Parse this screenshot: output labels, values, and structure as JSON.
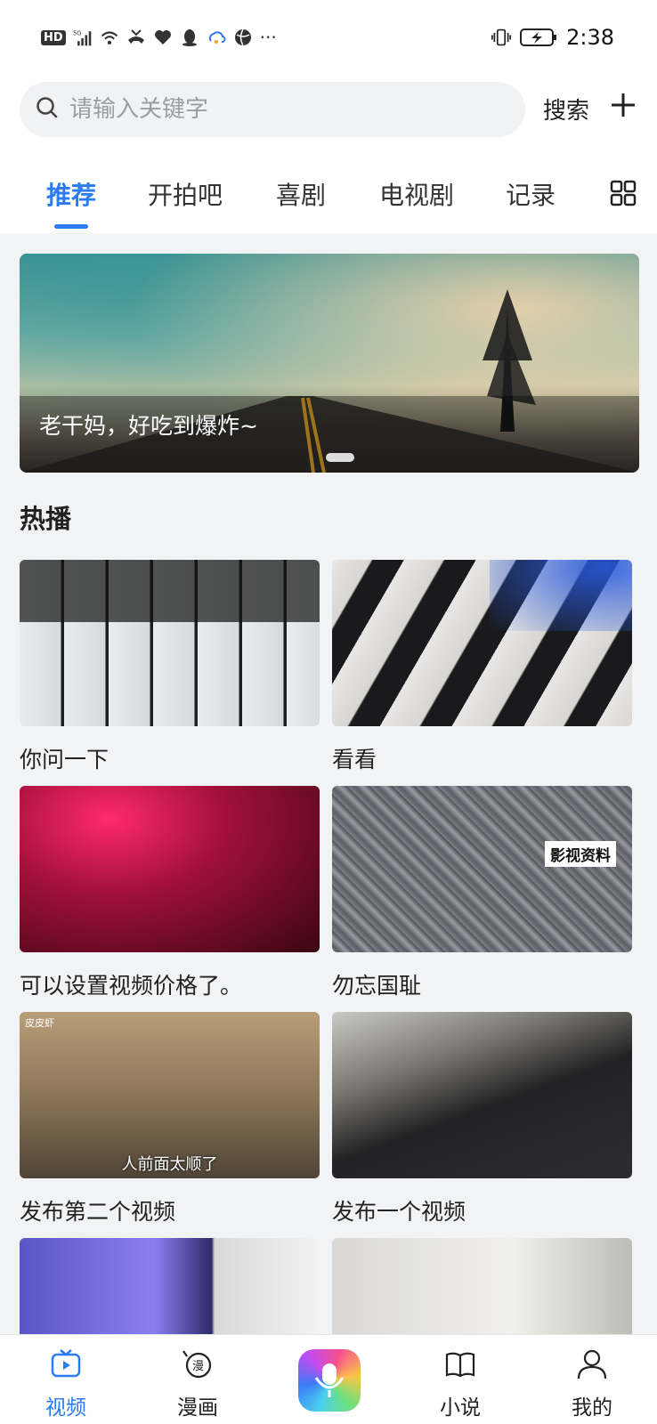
{
  "status_bar": {
    "network_badge": "HD",
    "signal_label": "5G",
    "wifi_label": "6",
    "more": "···",
    "time": "2:38"
  },
  "search": {
    "placeholder": "请输入关键字",
    "button_label": "搜索"
  },
  "tabs": [
    {
      "label": "推荐",
      "active": true
    },
    {
      "label": "开拍吧",
      "active": false
    },
    {
      "label": "喜剧",
      "active": false
    },
    {
      "label": "电视剧",
      "active": false
    },
    {
      "label": "记录",
      "active": false
    }
  ],
  "banner": {
    "caption": "老干妈，好吃到爆炸~"
  },
  "section": {
    "title": "热播"
  },
  "videos": [
    {
      "title": "你问一下"
    },
    {
      "title": "看看"
    },
    {
      "title": "可以设置视频价格了。"
    },
    {
      "title": "勿忘国耻",
      "overlay": "影视资料"
    },
    {
      "title": "发布第二个视频",
      "overlay": "人前面太顺了",
      "logo": "皮皮虾"
    },
    {
      "title": "发布一个视频"
    },
    {
      "title": ""
    },
    {
      "title": ""
    }
  ],
  "bottom_nav": [
    {
      "label": "视频",
      "icon": "tv-icon",
      "active": true
    },
    {
      "label": "漫画",
      "icon": "comic-icon",
      "active": false
    },
    {
      "label": "",
      "icon": "mic-app-icon",
      "active": false
    },
    {
      "label": "小说",
      "icon": "book-icon",
      "active": false
    },
    {
      "label": "我的",
      "icon": "user-icon",
      "active": false
    }
  ],
  "colors": {
    "accent": "#2b7bf3",
    "background": "#f2f3f5"
  }
}
